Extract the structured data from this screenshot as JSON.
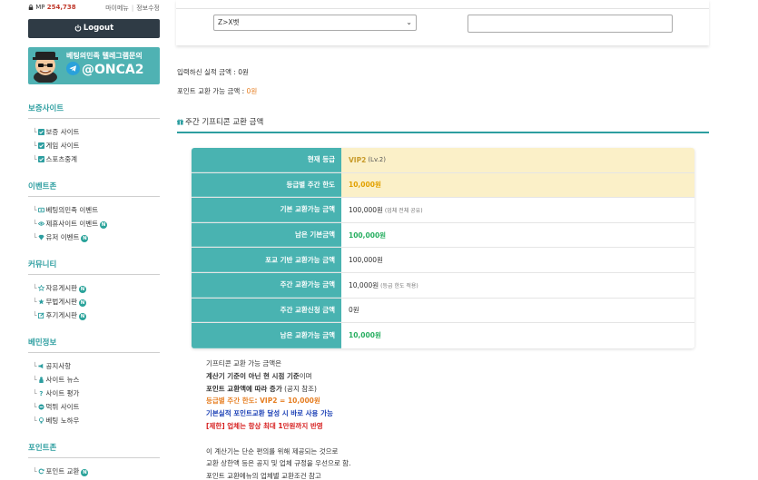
{
  "user": {
    "mp_label": "MP",
    "mp_value": "254,738",
    "my_menu": "마이메뉴",
    "edit_info": "정보수정",
    "logout": "Logout"
  },
  "banner": {
    "line1": "베팅의민족 텔레그램문의",
    "line2": "@ONCA2"
  },
  "sidebar": {
    "sections": [
      {
        "title": "보증사이트",
        "items": [
          {
            "label": "보증 사이트",
            "icon": "check-icon"
          },
          {
            "label": "게임 사이트",
            "icon": "check-icon"
          },
          {
            "label": "스포츠중계",
            "icon": "check-icon"
          }
        ]
      },
      {
        "title": "이벤트존",
        "items": [
          {
            "label": "베팅의민족 이벤트",
            "icon": "ticket-icon"
          },
          {
            "label": "제휴사이트 이벤트",
            "icon": "eye-icon",
            "badge": "N"
          },
          {
            "label": "유저 이벤트",
            "icon": "diamond-icon",
            "badge": "N"
          }
        ]
      },
      {
        "title": "커뮤니티",
        "items": [
          {
            "label": "자유게시판",
            "icon": "star-icon",
            "badge": "N"
          },
          {
            "label": "무법게시판",
            "icon": "star-fill-icon",
            "badge": "N"
          },
          {
            "label": "후기게시판",
            "icon": "edit-icon",
            "badge": "N"
          }
        ]
      },
      {
        "title": "베민정보",
        "items": [
          {
            "label": "공지사항",
            "icon": "megaphone-icon"
          },
          {
            "label": "사이트 뉴스",
            "icon": "person-icon"
          },
          {
            "label": "사이트 평가",
            "icon": "question-icon"
          },
          {
            "label": "먹튀 사이트",
            "icon": "minus-circle-icon"
          },
          {
            "label": "베팅 노하우",
            "icon": "bulb-icon"
          }
        ]
      },
      {
        "title": "포인트존",
        "items": [
          {
            "label": "포인트 교환",
            "icon": "refresh-icon",
            "badge": "N"
          }
        ]
      }
    ]
  },
  "form": {
    "site_select_value": "Z>X벳",
    "amount_value": ""
  },
  "info": {
    "deposit_label": "입력하신 실적 금액 : ",
    "deposit_value": "0원",
    "point_label": "포인트 교환 가능 금액 : ",
    "point_value": "0원"
  },
  "section_title": "주간 기프티콘 교환 금액",
  "table": {
    "rows": [
      {
        "label": "현재 등급",
        "value": "VIP2",
        "extra": "(Lv.2)"
      },
      {
        "label": "등급별 주간 한도",
        "value": "10,000원"
      },
      {
        "label": "기본 교환가능 금액",
        "value": "100,000원",
        "extra": "(업체 전체 공유)"
      },
      {
        "label": "남은 기본금액",
        "value": "100,000원"
      },
      {
        "label": "포교 기반 교환가능 금액",
        "value": "100,000원"
      },
      {
        "label": "주간 교환가능 금액",
        "value": "10,000원",
        "extra": "(등급 한도 적용)"
      },
      {
        "label": "주간 교환신청 금액",
        "value": "0원"
      },
      {
        "label": "남은 교환가능 금액",
        "value": "10,000원"
      }
    ]
  },
  "notes": {
    "n1": "기프티콘 교환 가능 금액은",
    "n2_bold": "계산기 기준이 아닌 현 시점 기준",
    "n2_rest": "이며",
    "n3_bold": "포인트 교환액에 따라 증가",
    "n3_rest": " (공지 참조)",
    "n4": "등급별 주간 한도: VIP2 = 10,000원",
    "n5": "기본실적 포인트교환 달성 시 바로 사용 가능",
    "n6": "[제한] 업체는 항상 최대 1만원까지 반영",
    "n7": "이 계산기는 단순 편의를 위해 제공되는 것으로",
    "n8": "교환 상한액 등은 공지 및 업체 규정을 우선으로 함.",
    "n9": "포인트 교환메뉴의 업체별 교환조건 참고"
  }
}
